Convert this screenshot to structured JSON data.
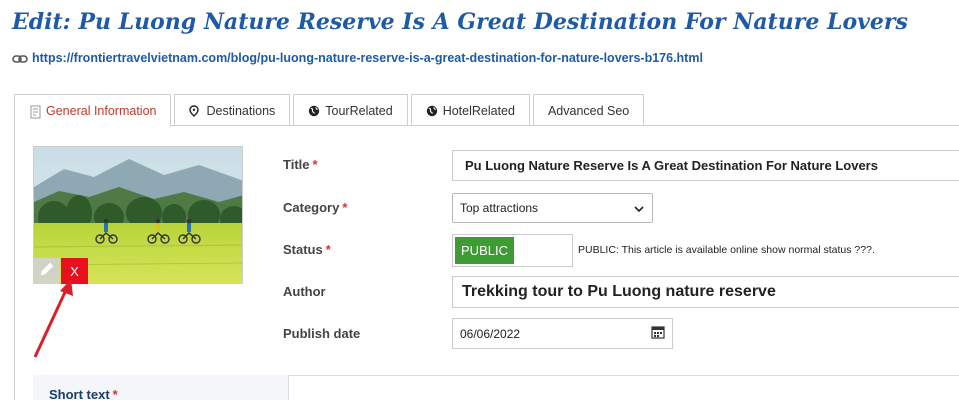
{
  "header": {
    "title": "Edit: Pu Luong Nature Reserve Is A Great Destination For Nature Lovers",
    "url": "https://frontiertravelvietnam.com/blog/pu-luong-nature-reserve-is-a-great-destination-for-nature-lovers-b176.html",
    "url_icon": "link-icon"
  },
  "tabs": [
    {
      "label": "General Information",
      "icon": "document-icon",
      "active": true
    },
    {
      "label": "Destinations",
      "icon": "map-marker-icon"
    },
    {
      "label": "TourRelated",
      "icon": "globe-icon"
    },
    {
      "label": "HotelRelated",
      "icon": "globe-icon"
    },
    {
      "label": "Advanced Seo"
    }
  ],
  "image": {
    "edit_icon": "pencil-icon",
    "delete_label": "X"
  },
  "form": {
    "title_label": "Title",
    "title_value": "Pu Luong Nature Reserve Is A Great Destination For Nature Lovers",
    "category_label": "Category",
    "category_value": "Top attractions",
    "status_label": "Status",
    "status_value": "PUBLIC",
    "status_note": "PUBLIC: This article is available online show normal status ???.",
    "author_label": "Author",
    "author_value": "Trekking tour to Pu Luong nature reserve",
    "publish_label": "Publish date",
    "publish_value": "06/06/2022",
    "required_mark": "*",
    "short_text_label": "Short text"
  },
  "colors": {
    "title_blue": "#1f5aa6",
    "active_tab": "#c0392b",
    "status_green": "#3f9c35",
    "delete_red": "#e8101c",
    "arrow_red": "#d7202a"
  }
}
